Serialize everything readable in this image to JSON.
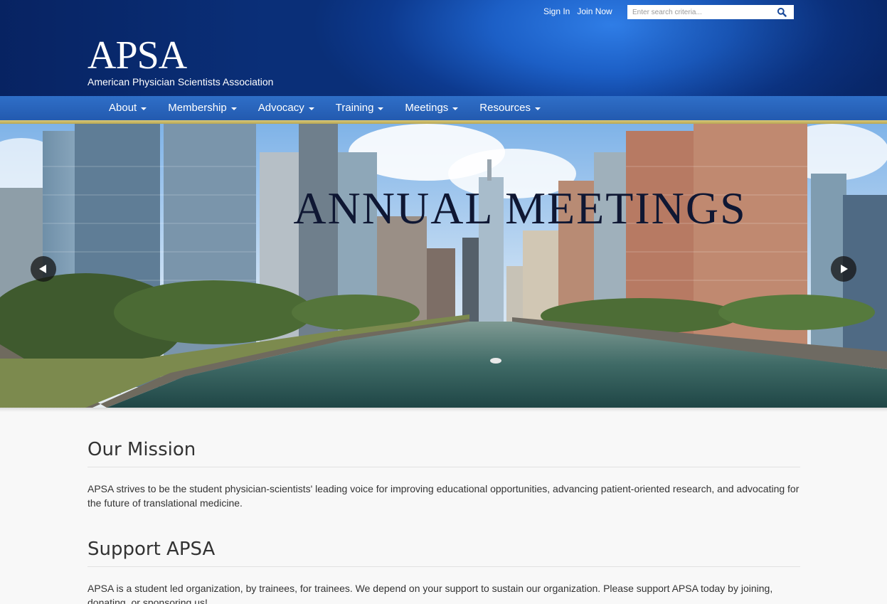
{
  "header": {
    "sign_in": "Sign In",
    "join_now": "Join Now",
    "search_placeholder": "Enter search criteria...",
    "logo_mark": "APSA",
    "logo_subtitle": "American Physician Scientists Association"
  },
  "nav": {
    "items": [
      {
        "label": "About"
      },
      {
        "label": "Membership"
      },
      {
        "label": "Advocacy"
      },
      {
        "label": "Training"
      },
      {
        "label": "Meetings"
      },
      {
        "label": "Resources"
      }
    ]
  },
  "hero": {
    "title": "ANNUAL MEETINGS"
  },
  "sections": [
    {
      "heading": "Our Mission",
      "body": "APSA strives to be the student physician-scientists' leading voice for improving educational opportunities, advancing patient-oriented research, and advocating for the future of translational medicine."
    },
    {
      "heading": "Support APSA",
      "body": "APSA is a student led organization, by trainees, for trainees. We depend on your support to sustain our organization. Please support APSA today by joining, donating, or sponsoring us!"
    }
  ],
  "colors": {
    "header_blue": "#1c5fc6",
    "nav_blue": "#2a66bf",
    "gold_rule": "#c9b865"
  }
}
